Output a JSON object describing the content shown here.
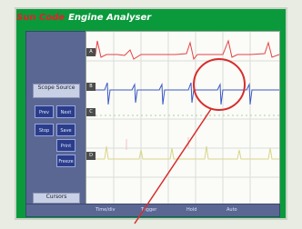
{
  "app": {
    "brand": "Sun Code",
    "title": "Engine Analyser"
  },
  "sidebar": {
    "label_1": "Scope Source",
    "buttons": [
      "Prev",
      "Next",
      "Stop",
      "Save",
      "Print",
      "Freeze"
    ],
    "label_2": "Cursors",
    "nav": [
      "◀",
      "▶"
    ]
  },
  "scope": {
    "trace_labels": [
      "A",
      "B",
      "C",
      "D"
    ]
  },
  "bottom": {
    "items": [
      "Time/div",
      "Trigger",
      "Hold",
      "Auto"
    ]
  },
  "colors": {
    "frame": "#0a9a3c",
    "sidebar": "#5b6793",
    "button": "#2b3d8a",
    "trace_red": "#e24444",
    "trace_blue": "#3c59c6",
    "trace_yellow": "#d9d58b",
    "annotation": "#d62d2d"
  },
  "icons": {
    "annotation": "red-circle-annotation-icon"
  }
}
